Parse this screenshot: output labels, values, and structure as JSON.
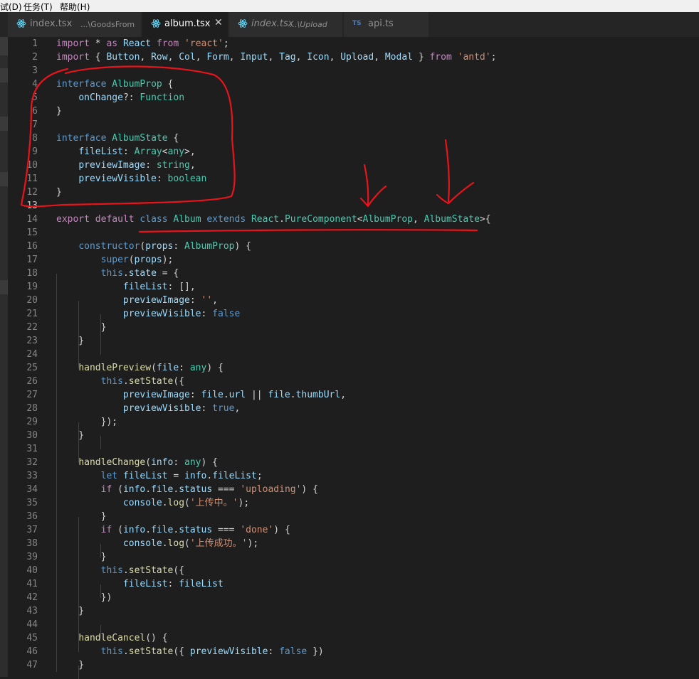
{
  "menubar": {
    "items": [
      "试(D)",
      "任务(T)",
      "帮助(H)"
    ]
  },
  "tabs": [
    {
      "name": "index.tsx",
      "path": "...\\GoodsFrom",
      "icon": "react-icon",
      "active": false
    },
    {
      "name": "album.tsx",
      "path": "",
      "icon": "react-icon",
      "active": true,
      "close": "✕"
    },
    {
      "name": "index.tsx",
      "path": "...\\Upload",
      "icon": "react-icon",
      "active": false
    },
    {
      "name": "api.ts",
      "path": "",
      "icon": "typescript-icon",
      "badge": "TS",
      "active": false
    }
  ],
  "editor": {
    "current_line": 13,
    "lines": [
      [
        [
          "kw",
          "import"
        ],
        [
          "pl",
          " * "
        ],
        [
          "kw",
          "as"
        ],
        [
          "pl",
          " "
        ],
        [
          "va",
          "React"
        ],
        [
          "pl",
          " "
        ],
        [
          "kw",
          "from"
        ],
        [
          "pl",
          " "
        ],
        [
          "st",
          "'react'"
        ],
        [
          "pl",
          ";"
        ]
      ],
      [
        [
          "kw",
          "import"
        ],
        [
          "pl",
          " { "
        ],
        [
          "va",
          "Button"
        ],
        [
          "pl",
          ", "
        ],
        [
          "va",
          "Row"
        ],
        [
          "pl",
          ", "
        ],
        [
          "va",
          "Col"
        ],
        [
          "pl",
          ", "
        ],
        [
          "va",
          "Form"
        ],
        [
          "pl",
          ", "
        ],
        [
          "va",
          "Input"
        ],
        [
          "pl",
          ", "
        ],
        [
          "va",
          "Tag"
        ],
        [
          "pl",
          ", "
        ],
        [
          "va",
          "Icon"
        ],
        [
          "pl",
          ", "
        ],
        [
          "va",
          "Upload"
        ],
        [
          "pl",
          ", "
        ],
        [
          "va",
          "Modal"
        ],
        [
          "pl",
          " } "
        ],
        [
          "kw",
          "from"
        ],
        [
          "pl",
          " "
        ],
        [
          "st",
          "'antd'"
        ],
        [
          "pl",
          ";"
        ]
      ],
      [],
      [
        [
          "kb",
          "interface"
        ],
        [
          "pl",
          " "
        ],
        [
          "ty",
          "AlbumProp"
        ],
        [
          "pl",
          " {"
        ]
      ],
      [
        [
          "pl",
          "    "
        ],
        [
          "va",
          "onChange"
        ],
        [
          "pl",
          "?: "
        ],
        [
          "ty",
          "Function"
        ]
      ],
      [
        [
          "pl",
          "}"
        ]
      ],
      [],
      [
        [
          "kb",
          "interface"
        ],
        [
          "pl",
          " "
        ],
        [
          "ty",
          "AlbumState"
        ],
        [
          "pl",
          " {"
        ]
      ],
      [
        [
          "pl",
          "    "
        ],
        [
          "va",
          "fileList"
        ],
        [
          "pl",
          ": "
        ],
        [
          "ty",
          "Array"
        ],
        [
          "pl",
          "<"
        ],
        [
          "ty",
          "any"
        ],
        [
          "pl",
          ">,"
        ]
      ],
      [
        [
          "pl",
          "    "
        ],
        [
          "va",
          "previewImage"
        ],
        [
          "pl",
          ": "
        ],
        [
          "ty",
          "string"
        ],
        [
          "pl",
          ","
        ]
      ],
      [
        [
          "pl",
          "    "
        ],
        [
          "va",
          "previewVisible"
        ],
        [
          "pl",
          ": "
        ],
        [
          "ty",
          "boolean"
        ]
      ],
      [
        [
          "pl",
          "}"
        ]
      ],
      [],
      [
        [
          "kw",
          "export"
        ],
        [
          "pl",
          " "
        ],
        [
          "kw",
          "default"
        ],
        [
          "pl",
          " "
        ],
        [
          "kb",
          "class"
        ],
        [
          "pl",
          " "
        ],
        [
          "ty",
          "Album"
        ],
        [
          "pl",
          " "
        ],
        [
          "kb",
          "extends"
        ],
        [
          "pl",
          " "
        ],
        [
          "ty",
          "React"
        ],
        [
          "pl",
          "."
        ],
        [
          "ty",
          "PureComponent"
        ],
        [
          "pl",
          "<"
        ],
        [
          "ty",
          "AlbumProp"
        ],
        [
          "pl",
          ", "
        ],
        [
          "ty",
          "AlbumState"
        ],
        [
          "pl",
          ">{"
        ]
      ],
      [],
      [
        [
          "pl",
          "    "
        ],
        [
          "kb",
          "constructor"
        ],
        [
          "pl",
          "("
        ],
        [
          "va",
          "props"
        ],
        [
          "pl",
          ": "
        ],
        [
          "ty",
          "AlbumProp"
        ],
        [
          "pl",
          ") {"
        ]
      ],
      [
        [
          "pl",
          "        "
        ],
        [
          "kb",
          "super"
        ],
        [
          "pl",
          "("
        ],
        [
          "va",
          "props"
        ],
        [
          "pl",
          ");"
        ]
      ],
      [
        [
          "pl",
          "        "
        ],
        [
          "kb",
          "this"
        ],
        [
          "pl",
          "."
        ],
        [
          "va",
          "state"
        ],
        [
          "pl",
          " = {"
        ]
      ],
      [
        [
          "pl",
          "            "
        ],
        [
          "va",
          "fileList"
        ],
        [
          "pl",
          ": [],"
        ]
      ],
      [
        [
          "pl",
          "            "
        ],
        [
          "va",
          "previewImage"
        ],
        [
          "pl",
          ": "
        ],
        [
          "st",
          "''"
        ],
        [
          "pl",
          ","
        ]
      ],
      [
        [
          "pl",
          "            "
        ],
        [
          "va",
          "previewVisible"
        ],
        [
          "pl",
          ": "
        ],
        [
          "kb",
          "false"
        ]
      ],
      [
        [
          "pl",
          "        }"
        ]
      ],
      [
        [
          "pl",
          "    }"
        ]
      ],
      [],
      [
        [
          "pl",
          "    "
        ],
        [
          "fn",
          "handlePreview"
        ],
        [
          "pl",
          "("
        ],
        [
          "va",
          "file"
        ],
        [
          "pl",
          ": "
        ],
        [
          "ty",
          "any"
        ],
        [
          "pl",
          ") {"
        ]
      ],
      [
        [
          "pl",
          "        "
        ],
        [
          "kb",
          "this"
        ],
        [
          "pl",
          "."
        ],
        [
          "fn",
          "setState"
        ],
        [
          "pl",
          "({"
        ]
      ],
      [
        [
          "pl",
          "            "
        ],
        [
          "va",
          "previewImage"
        ],
        [
          "pl",
          ": "
        ],
        [
          "va",
          "file"
        ],
        [
          "pl",
          "."
        ],
        [
          "va",
          "url"
        ],
        [
          "pl",
          " || "
        ],
        [
          "va",
          "file"
        ],
        [
          "pl",
          "."
        ],
        [
          "va",
          "thumbUrl"
        ],
        [
          "pl",
          ","
        ]
      ],
      [
        [
          "pl",
          "            "
        ],
        [
          "va",
          "previewVisible"
        ],
        [
          "pl",
          ": "
        ],
        [
          "kb",
          "true"
        ],
        [
          "pl",
          ","
        ]
      ],
      [
        [
          "pl",
          "        });"
        ]
      ],
      [
        [
          "pl",
          "    }"
        ]
      ],
      [],
      [
        [
          "pl",
          "    "
        ],
        [
          "fn",
          "handleChange"
        ],
        [
          "pl",
          "("
        ],
        [
          "va",
          "info"
        ],
        [
          "pl",
          ": "
        ],
        [
          "ty",
          "any"
        ],
        [
          "pl",
          ") {"
        ]
      ],
      [
        [
          "pl",
          "        "
        ],
        [
          "kb",
          "let"
        ],
        [
          "pl",
          " "
        ],
        [
          "va",
          "fileList"
        ],
        [
          "pl",
          " = "
        ],
        [
          "va",
          "info"
        ],
        [
          "pl",
          "."
        ],
        [
          "va",
          "fileList"
        ],
        [
          "pl",
          ";"
        ]
      ],
      [
        [
          "pl",
          "        "
        ],
        [
          "kw",
          "if"
        ],
        [
          "pl",
          " ("
        ],
        [
          "va",
          "info"
        ],
        [
          "pl",
          "."
        ],
        [
          "va",
          "file"
        ],
        [
          "pl",
          "."
        ],
        [
          "va",
          "status"
        ],
        [
          "pl",
          " === "
        ],
        [
          "st",
          "'uploading'"
        ],
        [
          "pl",
          ") {"
        ]
      ],
      [
        [
          "pl",
          "            "
        ],
        [
          "va",
          "console"
        ],
        [
          "pl",
          "."
        ],
        [
          "fn",
          "log"
        ],
        [
          "pl",
          "("
        ],
        [
          "st",
          "'上传中。'"
        ],
        [
          "pl",
          ");"
        ]
      ],
      [
        [
          "pl",
          "        }"
        ]
      ],
      [
        [
          "pl",
          "        "
        ],
        [
          "kw",
          "if"
        ],
        [
          "pl",
          " ("
        ],
        [
          "va",
          "info"
        ],
        [
          "pl",
          "."
        ],
        [
          "va",
          "file"
        ],
        [
          "pl",
          "."
        ],
        [
          "va",
          "status"
        ],
        [
          "pl",
          " === "
        ],
        [
          "st",
          "'done'"
        ],
        [
          "pl",
          ") {"
        ]
      ],
      [
        [
          "pl",
          "            "
        ],
        [
          "va",
          "console"
        ],
        [
          "pl",
          "."
        ],
        [
          "fn",
          "log"
        ],
        [
          "pl",
          "("
        ],
        [
          "st",
          "'上传成功。'"
        ],
        [
          "pl",
          ");"
        ]
      ],
      [
        [
          "pl",
          "        }"
        ]
      ],
      [
        [
          "pl",
          "        "
        ],
        [
          "kb",
          "this"
        ],
        [
          "pl",
          "."
        ],
        [
          "fn",
          "setState"
        ],
        [
          "pl",
          "({"
        ]
      ],
      [
        [
          "pl",
          "            "
        ],
        [
          "va",
          "fileList"
        ],
        [
          "pl",
          ": "
        ],
        [
          "va",
          "fileList"
        ]
      ],
      [
        [
          "pl",
          "        })"
        ]
      ],
      [
        [
          "pl",
          "    }"
        ]
      ],
      [],
      [
        [
          "pl",
          "    "
        ],
        [
          "fn",
          "handleCancel"
        ],
        [
          "pl",
          "() {"
        ]
      ],
      [
        [
          "pl",
          "        "
        ],
        [
          "kb",
          "this"
        ],
        [
          "pl",
          "."
        ],
        [
          "fn",
          "setState"
        ],
        [
          "pl",
          "({ "
        ],
        [
          "va",
          "previewVisible"
        ],
        [
          "pl",
          ": "
        ],
        [
          "kb",
          "false"
        ],
        [
          "pl",
          " })"
        ]
      ],
      [
        [
          "pl",
          "    }"
        ]
      ]
    ]
  },
  "colors": {
    "background": "#1e1e1e",
    "annotation": "#e8141c",
    "keyword_control": "#c586c0",
    "keyword": "#569cd6",
    "type": "#4ec9b0",
    "function": "#dcdcaa",
    "string": "#ce9178",
    "variable": "#9cdcfe"
  }
}
